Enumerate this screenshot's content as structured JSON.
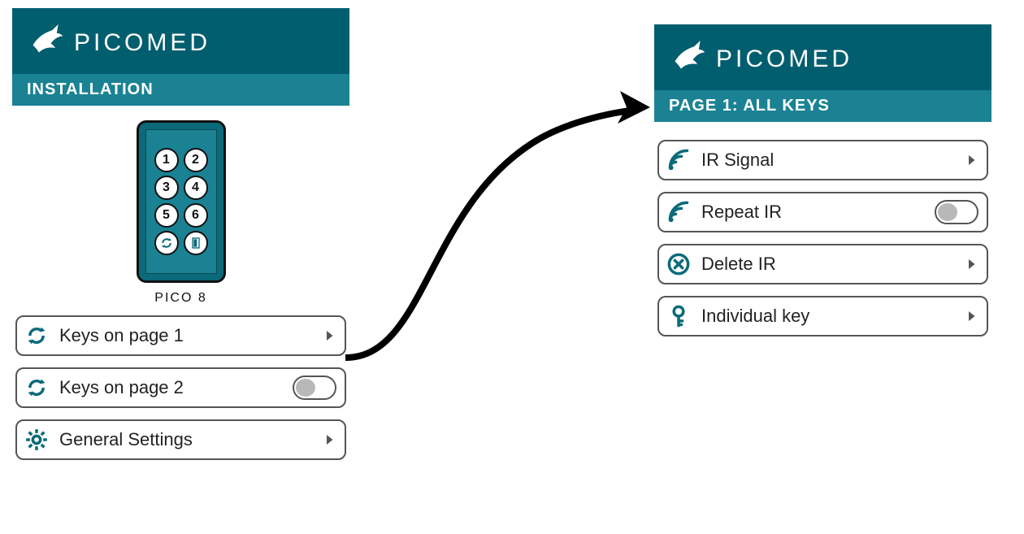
{
  "brand": "PICOMED",
  "colors": {
    "brand": "#005e6e",
    "accent": "#1a8293"
  },
  "left": {
    "subtitle": "INSTALLATION",
    "device_label": "PICO 8",
    "keys": [
      "1",
      "2",
      "3",
      "4",
      "5",
      "6"
    ],
    "menu": [
      {
        "label": "Keys on page 1",
        "icon": "cycle",
        "tail": "chevron"
      },
      {
        "label": "Keys on page 2",
        "icon": "cycle",
        "tail": "toggle-off"
      },
      {
        "label": "General Settings",
        "icon": "gear",
        "tail": "chevron"
      }
    ]
  },
  "right": {
    "subtitle": "PAGE 1: ALL KEYS",
    "menu": [
      {
        "label": "IR Signal",
        "icon": "signal",
        "tail": "chevron"
      },
      {
        "label": "Repeat IR",
        "icon": "signal",
        "tail": "toggle-off"
      },
      {
        "label": "Delete IR",
        "icon": "delete",
        "tail": "chevron"
      },
      {
        "label": "Individual key",
        "icon": "key",
        "tail": "chevron"
      }
    ]
  }
}
